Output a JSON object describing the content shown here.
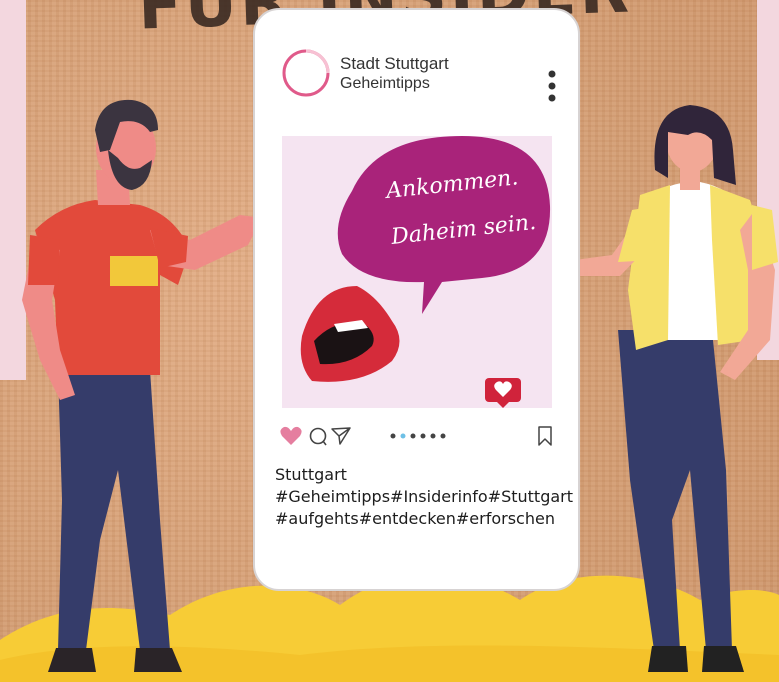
{
  "headline": "FÜR INSIDER",
  "profile": {
    "name": "Stadt Stuttgart",
    "subtitle": "Geheimtipps"
  },
  "post": {
    "speech_line1": "Ankommen.",
    "speech_line2": "Daheim sein.",
    "carousel_dots": 6,
    "active_dot": 1
  },
  "caption": {
    "title": "Stuttgart",
    "hashtags_line1": "#Geheimtipps#Insiderinfo#Stuttgart",
    "hashtags_line2": "#aufgehts#entdecken#erforschen"
  },
  "icons": {
    "like": "heart-icon",
    "comment": "comment-icon",
    "share": "send-icon",
    "save": "bookmark-icon",
    "more": "more-vertical-icon",
    "notification": "heart-notification-icon"
  },
  "colors": {
    "accent_pink": "#e05a8a",
    "speech_bubble": "#a9237a",
    "like_heart": "#e57e9f",
    "lips": "#d52b3a"
  }
}
